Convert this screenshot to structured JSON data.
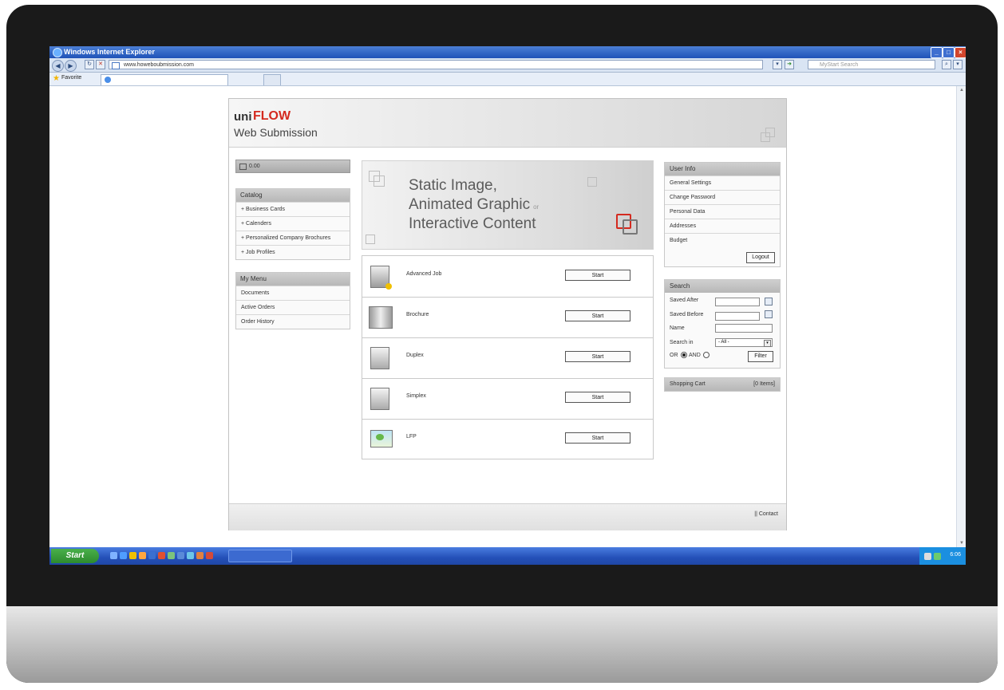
{
  "browser": {
    "window_title": "Windows Internet Explorer",
    "address": "www.howeboubmission.com",
    "search_placeholder": "MyStart Search",
    "favorites_label": "Favorite"
  },
  "taskbar": {
    "start_label": "Start",
    "clock": "6:06"
  },
  "header": {
    "logo_uni": "uni",
    "logo_flow": "FLOW",
    "subtitle": "Web Submission"
  },
  "cart_summary": {
    "amount": "0.00"
  },
  "catalog": {
    "title": "Catalog",
    "items": [
      "+ Business Cards",
      "+ Calenders",
      "+ Personalized Company Brochures",
      "+ Job Profiles"
    ]
  },
  "my_menu": {
    "title": "My Menu",
    "items": [
      "Documents",
      "Active Orders",
      "Order History"
    ]
  },
  "banner": {
    "line1": "Static Image,",
    "line2": "Animated Graphic",
    "or": "or",
    "line3": "Interactive Content"
  },
  "jobs": {
    "start_label": "Start",
    "items": [
      {
        "label": "Advanced Job",
        "icon": "advanced-job-icon"
      },
      {
        "label": "Brochure",
        "icon": "brochure-icon"
      },
      {
        "label": "Duplex",
        "icon": "duplex-icon"
      },
      {
        "label": "Simplex",
        "icon": "simplex-icon"
      },
      {
        "label": "LFP",
        "icon": "lfp-icon"
      }
    ]
  },
  "user_info": {
    "title": "User Info",
    "items": [
      "General Settings",
      "Change Password",
      "Personal Data",
      "Addresses",
      "Budget"
    ],
    "logout_label": "Logout"
  },
  "search": {
    "title": "Search",
    "saved_after_label": "Saved After",
    "saved_after_value": "",
    "saved_before_label": "Saved Before",
    "saved_before_value": "",
    "name_label": "Name",
    "name_value": "",
    "search_in_label": "Search in",
    "search_in_value": "- All -",
    "or_label": "OR",
    "and_label": "AND",
    "logic_selected": "OR",
    "filter_label": "Filter"
  },
  "shopping_cart": {
    "label": "Shopping Cart",
    "count": "[0 Items]"
  },
  "footer": {
    "contact": "|| Contact"
  },
  "colors": {
    "brand_red": "#d42a1f",
    "xp_blue": "#2450b8",
    "start_green": "#2d8a2e"
  }
}
